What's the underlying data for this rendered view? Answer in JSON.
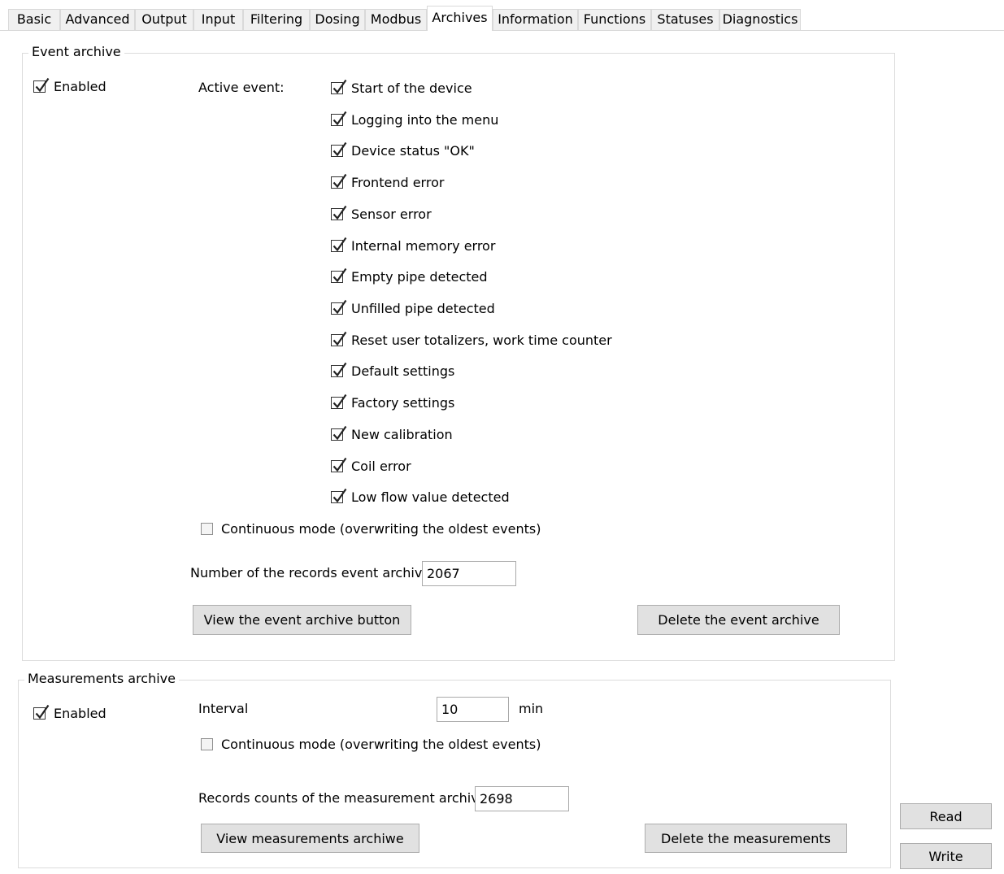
{
  "tabs": [
    "Basic",
    "Advanced",
    "Output",
    "Input",
    "Filtering",
    "Dosing",
    "Modbus",
    "Archives",
    "Information",
    "Functions",
    "Statuses",
    "Diagnostics"
  ],
  "active_tab": "Archives",
  "event_archive": {
    "title": "Event archive",
    "enabled_label": "Enabled",
    "enabled_checked": true,
    "active_event_label": "Active event:",
    "events": [
      {
        "label": "Start of the device",
        "checked": true
      },
      {
        "label": "Logging into the menu",
        "checked": true
      },
      {
        "label": "Device status \"OK\"",
        "checked": true
      },
      {
        "label": "Frontend error",
        "checked": true
      },
      {
        "label": "Sensor error",
        "checked": true
      },
      {
        "label": "Internal memory error",
        "checked": true
      },
      {
        "label": "Empty pipe detected",
        "checked": true
      },
      {
        "label": "Unfilled pipe detected",
        "checked": true
      },
      {
        "label": "Reset user totalizers, work time counter",
        "checked": true
      },
      {
        "label": "Default settings",
        "checked": true
      },
      {
        "label": "Factory settings",
        "checked": true
      },
      {
        "label": "New calibration",
        "checked": true
      },
      {
        "label": "Coil error",
        "checked": true
      },
      {
        "label": "Low flow value detected",
        "checked": true
      }
    ],
    "continuous_label": "Continuous mode (overwriting the oldest events)",
    "continuous_checked": false,
    "records_label": "Number of the records event archive",
    "records_value": "2067",
    "view_button": "View the event archive button",
    "delete_button": "Delete the event archive"
  },
  "measurements_archive": {
    "title": "Measurements archive",
    "enabled_label": "Enabled",
    "enabled_checked": true,
    "interval_label": "Interval",
    "interval_value": "10",
    "interval_unit": "min",
    "continuous_label": "Continuous mode (overwriting the oldest events)",
    "continuous_checked": false,
    "records_label": "Records counts of the measurement archive",
    "records_value": "2698",
    "view_button": "View measurements archiwe",
    "delete_button": "Delete the measurements"
  },
  "actions": {
    "read": "Read",
    "write": "Write"
  }
}
